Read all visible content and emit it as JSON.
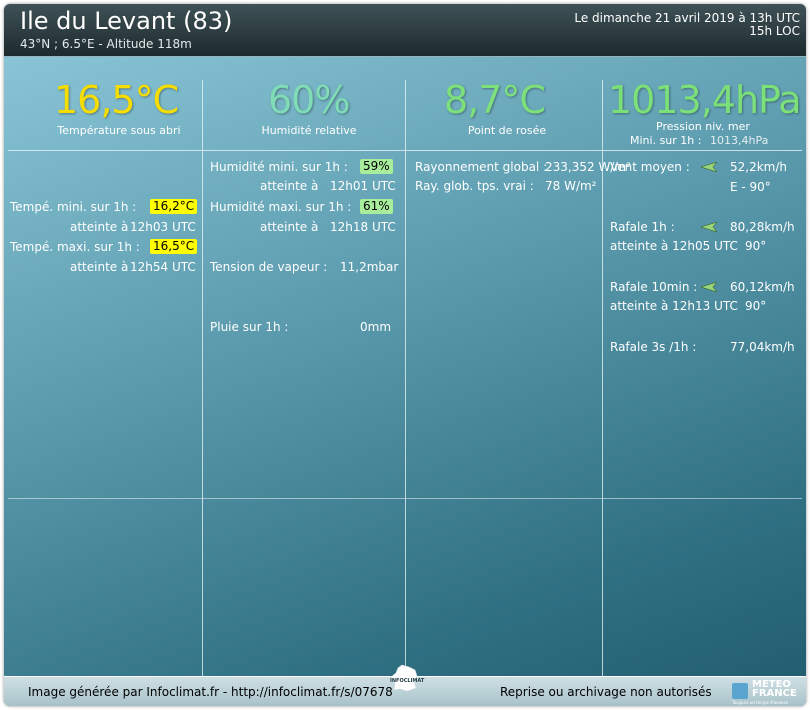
{
  "header": {
    "station": "Ile du Levant (83)",
    "coords": "43°N ; 6.5°E - Altitude 118m",
    "date_line1": "Le dimanche 21 avril 2019 à 13h UTC",
    "date_line2": "15h LOC"
  },
  "colors": {
    "temp": "#f6dd00",
    "humidity": "#7fdcb6",
    "dew": "#7de07a",
    "pressure": "#7ce079"
  },
  "temperature": {
    "value": "16,5°C",
    "caption": "Température sous abri",
    "min_label": "Tempé. mini. sur 1h :",
    "min_value": "16,2°C",
    "min_time_label": "atteinte à",
    "min_time": "12h03 UTC",
    "max_label": "Tempé. maxi. sur 1h :",
    "max_value": "16,5°C",
    "max_time_label": "atteinte à",
    "max_time": "12h54 UTC"
  },
  "humidity": {
    "value": "60%",
    "caption": "Humidité relative",
    "min_label": "Humidité mini. sur 1h :",
    "min_value": "59%",
    "min_time_label": "atteinte à",
    "min_time": "12h01 UTC",
    "max_label": "Humidité maxi. sur 1h :",
    "max_value": "61%",
    "max_time_label": "atteinte à",
    "max_time": "12h18 UTC",
    "vapor_label": "Tension de vapeur :",
    "vapor_value": "11,2mbar",
    "rain_label": "Pluie sur 1h :",
    "rain_value": "0mm"
  },
  "dewpoint": {
    "value": "8,7°C",
    "caption": "Point de rosée",
    "global_label": "Rayonnement global :",
    "global_value": "233,352 W/m²",
    "true_label": "Ray. glob. tps. vrai :",
    "true_value": "78 W/m²"
  },
  "pressure": {
    "value": "1013,4hPa",
    "caption": "Pression niv. mer",
    "min_label": "Mini. sur 1h :",
    "min_value": "1013,4hPa"
  },
  "wind": {
    "mean_label": "Vent moyen :",
    "mean_value": "52,2km/h",
    "mean_dir": "E - 90°",
    "gust1h_label": "Rafale 1h :",
    "gust1h_value": "80,28km/h",
    "gust1h_time": "atteinte à 12h05 UTC",
    "gust1h_dir": "90°",
    "gust10_label": "Rafale 10min :",
    "gust10_value": "60,12km/h",
    "gust10_time": "atteinte à 12h13 UTC",
    "gust10_dir": "90°",
    "gust3s_label": "Rafale 3s /1h :",
    "gust3s_value": "77,04km/h"
  },
  "footer": {
    "left": "Image générée par Infoclimat.fr - http://infoclimat.fr/s/07678",
    "right": "Reprise ou archivage non autorisés",
    "logo_text": "METEO FRANCE",
    "logo_tagline": "Toujours un temps d'avance",
    "ic_logo_text": "INFOCLIMAT"
  },
  "icons": {
    "wind_arrow": "wind-arrow-icon",
    "france": "france-map-icon"
  }
}
